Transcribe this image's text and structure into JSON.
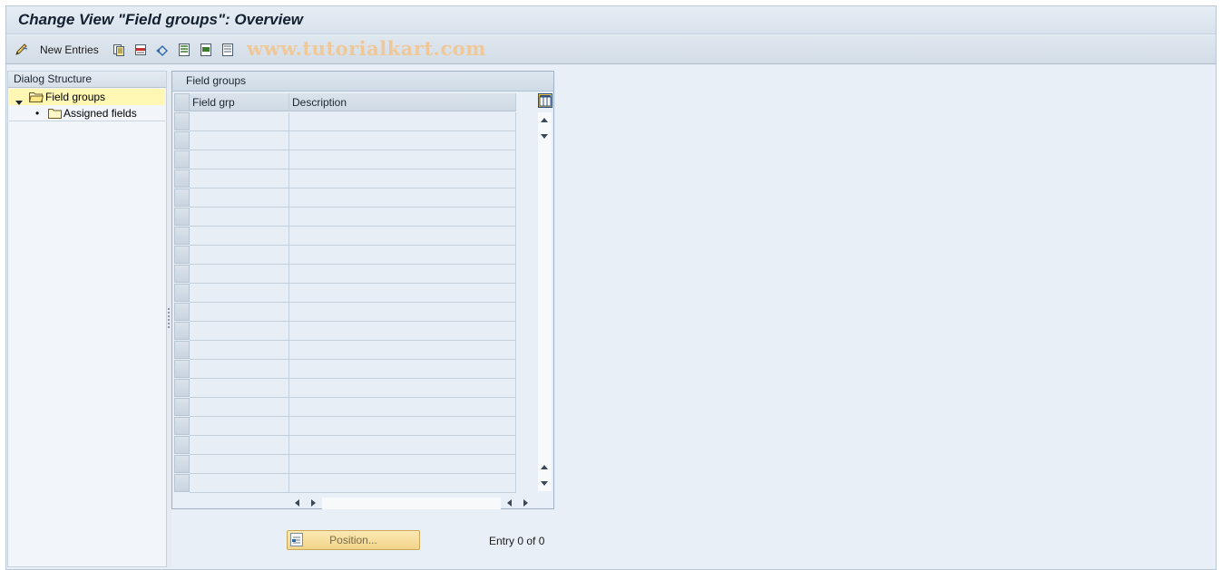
{
  "title": "Change View \"Field groups\": Overview",
  "toolbar": {
    "new_entries_label": "New Entries",
    "icons": [
      "edit-pencil-icon",
      "copy-icon",
      "delete-icon",
      "undo-change-icon",
      "select-all-icon",
      "select-block-icon",
      "deselect-all-icon"
    ]
  },
  "watermark": "www.tutorialkart.com",
  "dialog_structure": {
    "header": "Dialog Structure",
    "items": [
      {
        "label": "Field groups",
        "selected": true,
        "expanded": true
      },
      {
        "label": "Assigned fields",
        "selected": false
      }
    ]
  },
  "table": {
    "title": "Field groups",
    "columns": [
      "Field grp",
      "Description"
    ],
    "rows": []
  },
  "footer": {
    "position_button": "Position...",
    "entry_text": "Entry 0 of 0"
  }
}
